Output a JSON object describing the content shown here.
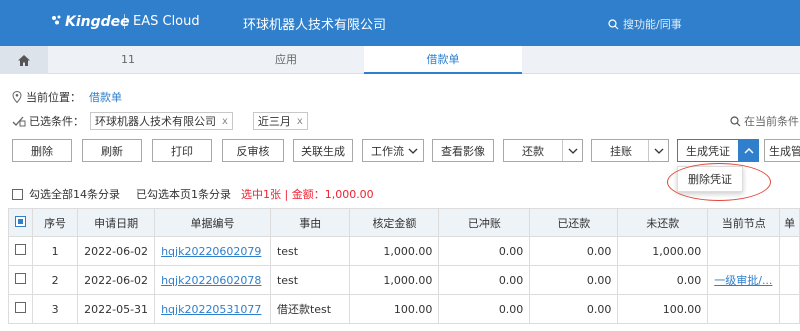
{
  "header": {
    "logo": "Kingdee",
    "product": "EAS Cloud",
    "company": "环球机器人技术有限公司",
    "search_placeholder": "搜功能/同事"
  },
  "tabs": [
    {
      "label": "11",
      "active": false
    },
    {
      "label": "应用",
      "active": false
    },
    {
      "label": "借款单",
      "active": true
    }
  ],
  "location": {
    "label": "当前位置：",
    "value": "借款单"
  },
  "filters": {
    "label": "已选条件：",
    "chips": [
      {
        "label": "环球机器人技术有限公司"
      },
      {
        "label": "近三月"
      }
    ],
    "search_placeholder": "在当前条件"
  },
  "toolbar": {
    "delete": "删除",
    "refresh": "刷新",
    "print": "打印",
    "unaudit": "反审核",
    "related": "关联生成",
    "workflow": "工作流",
    "view_image": "查看影像",
    "repay": "还款",
    "hang": "挂账",
    "gen_voucher": "生成凭证",
    "gen_more": "生成管"
  },
  "dropdown": {
    "item": "删除凭证"
  },
  "summary": {
    "select_all": "勾选全部14条分录",
    "select_page": "已勾选本页1条分录",
    "selected": "选中1张 | 金额：1,000.00"
  },
  "table": {
    "headers": [
      "序号",
      "申请日期",
      "单据编号",
      "事由",
      "核定金额",
      "已冲账",
      "已还款",
      "未还款",
      "当前节点",
      "单"
    ],
    "rows": [
      {
        "no": "1",
        "date": "2022-06-02",
        "code": "hqjk20220602079",
        "reason": "test",
        "approved": "1,000.00",
        "offset": "0.00",
        "repaid": "0.00",
        "unpaid": "1,000.00",
        "node": ""
      },
      {
        "no": "2",
        "date": "2022-06-02",
        "code": "hqjk20220602078",
        "reason": "test",
        "approved": "1,000.00",
        "offset": "0.00",
        "repaid": "0.00",
        "unpaid": "0.00",
        "node": "一级审批/..."
      },
      {
        "no": "3",
        "date": "2022-05-31",
        "code": "hqjk20220531077",
        "reason": "借还款test",
        "approved": "100.00",
        "offset": "0.00",
        "repaid": "0.00",
        "unpaid": "100.00",
        "node": ""
      }
    ]
  },
  "colors": {
    "brand": "#2f7fcc",
    "highlight_ring": "#e0483a",
    "selected_text": "#ee2233"
  }
}
